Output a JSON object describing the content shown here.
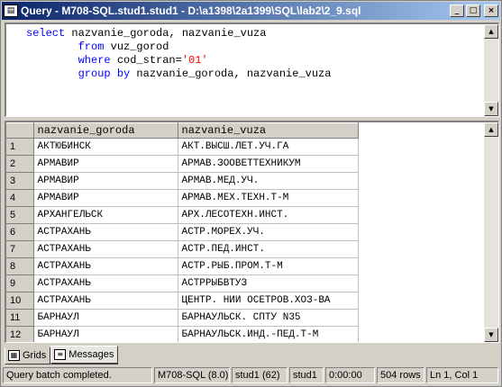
{
  "window": {
    "title": "Query - M708-SQL.stud1.stud1 - D:\\a1398\\2a1399\\SQL\\lab2\\2_9.sql",
    "buttons": {
      "minimize": "_",
      "maximize": "□",
      "close": "×"
    }
  },
  "editor": {
    "lines": [
      {
        "kw": "select",
        "rest": " nazvanie_goroda, nazvanie_vuza"
      },
      {
        "kw": "from",
        "rest": " vuz_gorod"
      },
      {
        "kw": "where",
        "rest": " cod_stran=",
        "str": "'01'"
      },
      {
        "kw": "group by",
        "rest": " nazvanie_goroda, nazvanie_vuza"
      }
    ]
  },
  "grid": {
    "columns": [
      "nazvanie_goroda",
      "nazvanie_vuza"
    ],
    "rows": [
      [
        "1",
        "АКТЮБИНСК",
        "АКТ.ВЫСШ.ЛЕТ.УЧ.ГА"
      ],
      [
        "2",
        "АРМАВИР",
        "АРМАВ.ЗООВЕТТЕХНИКУМ"
      ],
      [
        "3",
        "АРМАВИР",
        "АРМАВ.МЕД.УЧ."
      ],
      [
        "4",
        "АРМАВИР",
        "АРМАВ.МЕХ.ТЕХН.Т-М"
      ],
      [
        "5",
        "АРХАНГЕЛЬСК",
        "АРХ.ЛЕСОТЕХН.ИНСТ."
      ],
      [
        "6",
        "АСТРАХАНЬ",
        "АСТР.МОРЕХ.УЧ."
      ],
      [
        "7",
        "АСТРАХАНЬ",
        "АСТР.ПЕД.ИНСТ."
      ],
      [
        "8",
        "АСТРАХАНЬ",
        "АСТР.РЫБ.ПРОМ.Т-М"
      ],
      [
        "9",
        "АСТРАХАНЬ",
        "АСТРРЫБВТУЗ"
      ],
      [
        "10",
        "АСТРАХАНЬ",
        "ЦЕНТР. НИИ ОСЕТРОВ.ХОЗ-ВА"
      ],
      [
        "11",
        "БАРНАУЛ",
        "БАРНАУЛЬСК. СПТУ N35"
      ],
      [
        "12",
        "БАРНАУЛ",
        "БАРНАУЛЬСК.ИНД.-ПЕД.Т-М"
      ]
    ]
  },
  "tabs": [
    {
      "label": "Grids",
      "icon": "grid-icon",
      "active": false
    },
    {
      "label": "Messages",
      "icon": "messages-icon",
      "active": true
    }
  ],
  "status": {
    "message": "Query batch completed.",
    "server": "M708-SQL (8.0)",
    "user": "stud1 (62)",
    "database": "stud1",
    "elapsed": "0:00:00",
    "rows": "504 rows",
    "position": "Ln 1, Col 1"
  }
}
